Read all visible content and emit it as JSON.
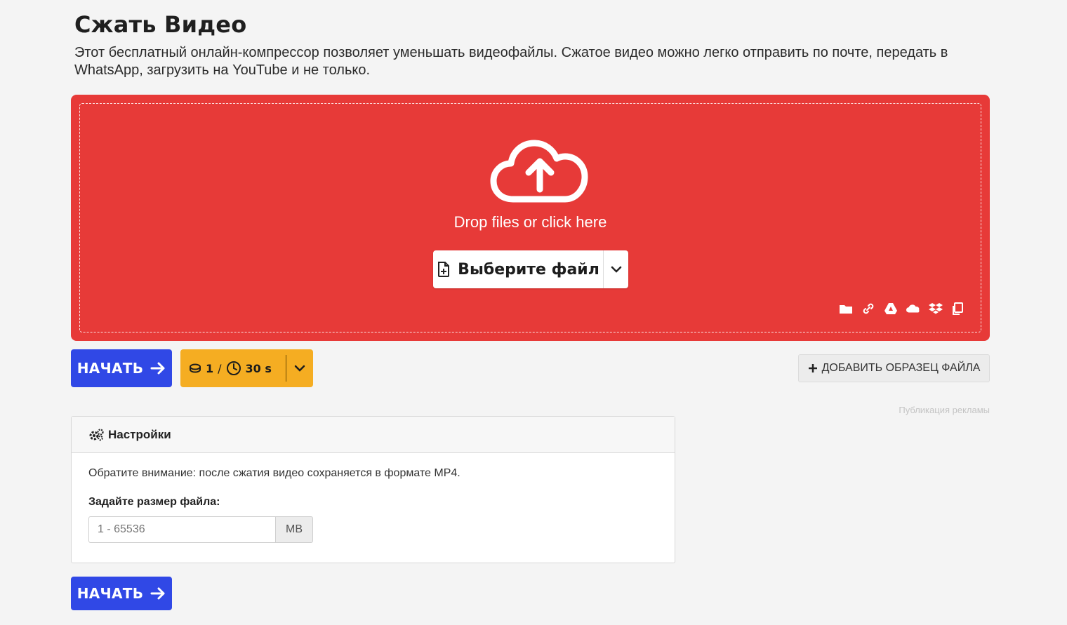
{
  "page": {
    "title": "Сжать Видео",
    "description": "Этот бесплатный онлайн-компрессор позволяет уменьшать видеофайлы. Сжатое видео можно легко отправить по почте, передать в WhatsApp, загрузить на YouTube и не только."
  },
  "dropzone": {
    "prompt": "Drop files or click here",
    "choose_label": "Выберите файл",
    "source_icons": [
      "folder-icon",
      "link-icon",
      "google-drive-icon",
      "onedrive-icon",
      "dropbox-icon",
      "clipboard-icon"
    ],
    "background_color": "#e73a38"
  },
  "actions": {
    "start_label": "НАЧАТЬ",
    "credits": {
      "count": "1",
      "separator": "/",
      "time": "30 s"
    },
    "sample_label": "ДОБАВИТЬ ОБРАЗЕЦ ФАЙЛА",
    "ad_label": "Публикация рекламы",
    "start_color": "#3048e6",
    "credits_color": "#f5ad22"
  },
  "settings": {
    "title": "Настройки",
    "note": "Обратите внимание: после сжатия видео сохраняется в формате MP4.",
    "size_label": "Задайте размер файла:",
    "size_placeholder": "1 - 65536",
    "size_value": "",
    "size_unit": "MB"
  }
}
